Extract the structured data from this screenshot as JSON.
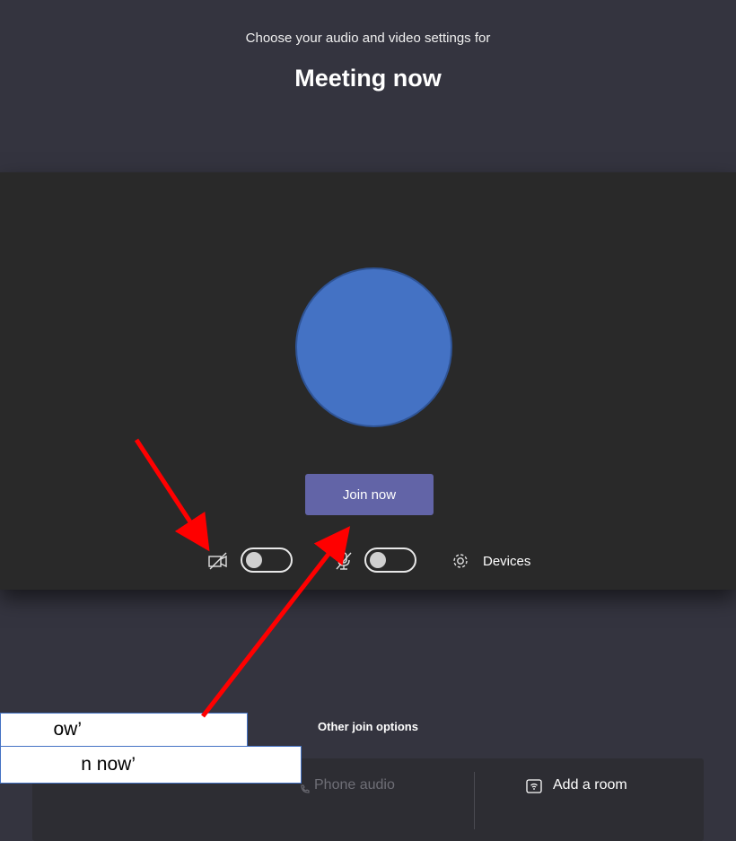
{
  "header": {
    "subtitle": "Choose your audio and video settings for",
    "title": "Meeting now"
  },
  "preview": {
    "join_label": "Join now",
    "camera": {
      "state": "off",
      "icon": "camera-off-icon"
    },
    "mic": {
      "state": "off",
      "icon": "mic-off-icon"
    },
    "devices_label": "Devices"
  },
  "other_options": {
    "title": "Other join options",
    "phone_audio_label": "Phone audio",
    "add_room_label": "Add a room"
  },
  "callouts": [
    {
      "text": "ow’"
    },
    {
      "text": "n now’"
    }
  ],
  "colors": {
    "background": "#34343f",
    "preview": "#292929",
    "accent": "#6264a7",
    "avatar": "#4472c4",
    "arrow": "#ff0000"
  }
}
